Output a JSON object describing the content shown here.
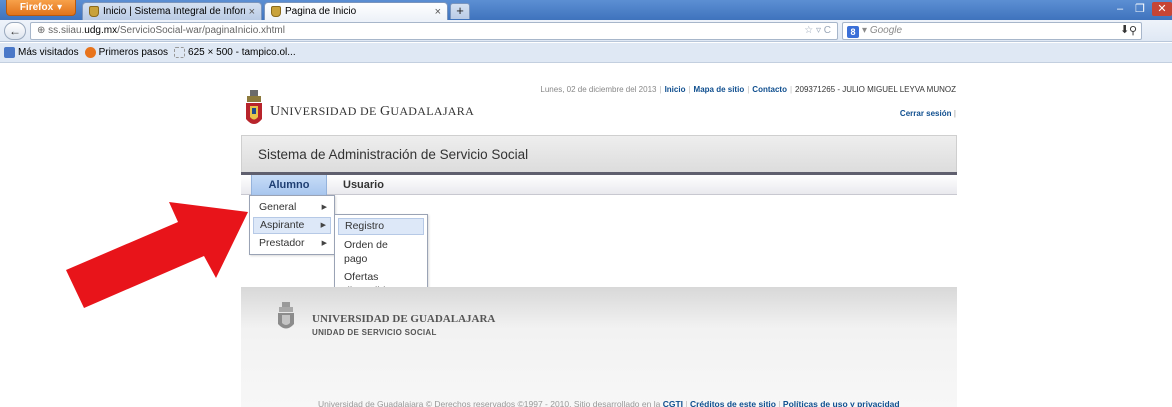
{
  "browser": {
    "firefox_label": "Firefox",
    "tabs": [
      {
        "title": "Inicio | Sistema Integral de Informaci..."
      },
      {
        "title": "Pagina de Inicio"
      }
    ],
    "new_tab": "+",
    "url_prefix": "ss.siiau.",
    "url_domain": "udg.mx",
    "url_path": "/ServicioSocial-war/paginaInicio.xhtml",
    "search_placeholder": "Google",
    "bookmarks": [
      "Más visitados",
      "Primeros pasos",
      "625 × 500 - tampico.ol..."
    ]
  },
  "page": {
    "date": "Lunes, 02 de diciembre del 2013",
    "links": [
      "Inicio",
      "Mapa de sitio",
      "Contacto"
    ],
    "user": "209371265 - JULIO MIGUEL LEYVA MUNOZ",
    "logout": "Cerrar sesión",
    "logo_first": "U",
    "logo_rest": "NIVERSIDAD DE ",
    "logo_g": "G",
    "logo_rest2": "UADALAJARA",
    "system_title": "Sistema de Administración de Servicio Social",
    "menu": [
      "Alumno",
      "Usuario"
    ],
    "submenu": [
      "General",
      "Aspirante",
      "Prestador"
    ],
    "subsubmenu": [
      "Registro",
      "Orden de pago",
      "Ofertas disponibles"
    ],
    "subsubmenu_lines": {
      "orden_1": "Orden de",
      "orden_2": "pago",
      "ofertas_1": "Ofertas",
      "ofertas_2": "disponibles"
    },
    "footer_name": "UNIVERSIDAD DE GUADALAJARA",
    "footer_unit": "UNIDAD DE SERVICIO SOCIAL",
    "footer_text": "Universidad de Guadalajara © Derechos reservados ©1997 - 2010. Sitio desarrollado en la ",
    "footer_links": [
      "CGTI",
      "Créditos de este sitio",
      "Políticas de uso y privacidad"
    ]
  },
  "colors": {
    "arrow": "#e8141a",
    "link": "#104f8f",
    "menu_active": "#a8c6ee"
  }
}
